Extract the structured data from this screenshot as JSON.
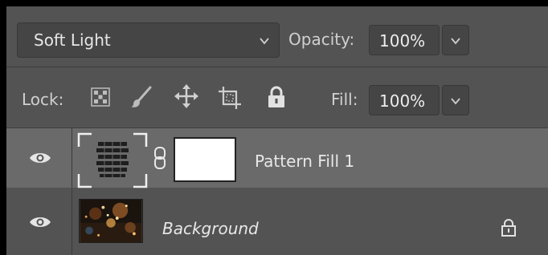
{
  "blend": {
    "mode": "Soft Light",
    "opacity_label": "Opacity:",
    "opacity_value": "100%"
  },
  "lock": {
    "label": "Lock:",
    "fill_label": "Fill:",
    "fill_value": "100%",
    "icons": [
      "transparency-lock-icon",
      "brush-lock-icon",
      "move-lock-icon",
      "artboard-lock-icon",
      "padlock-icon"
    ]
  },
  "layers": [
    {
      "name": "Pattern Fill 1",
      "type": "pattern-fill",
      "visible": true,
      "selected": true,
      "locked": false
    },
    {
      "name": "Background",
      "type": "image",
      "visible": true,
      "selected": false,
      "locked": true
    }
  ],
  "colors": {
    "panel": "#535353",
    "selected_layer": "#6a6a6a",
    "field": "#454545"
  }
}
